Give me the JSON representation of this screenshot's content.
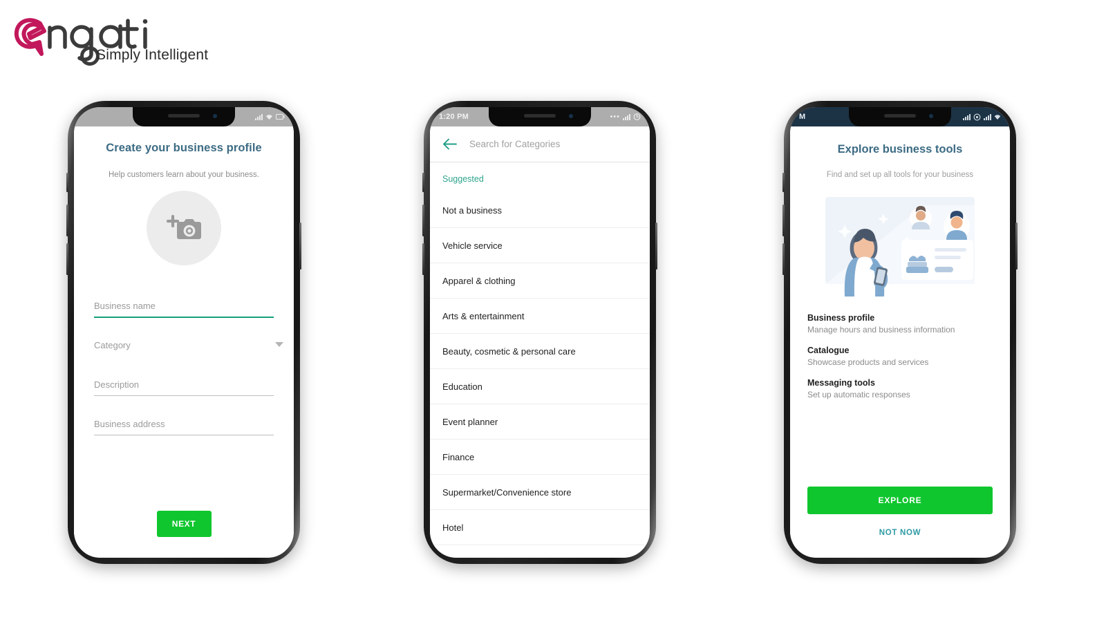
{
  "brand": {
    "name": "engati",
    "tagline": "Simply Intelligent",
    "mark_color": "#c2185b",
    "wordmark_color": "#3b3b3b"
  },
  "colors": {
    "primary_green": "#10c62e",
    "teal": "#2fa48d",
    "title_blue": "#3c6b83",
    "link_teal": "#2e9aa4",
    "field_active": "#14a07c"
  },
  "phones": [
    {
      "id": "create-business-profile",
      "status_bar": {
        "theme": "light",
        "time": "",
        "icons": [
          "signal-icon",
          "wifi-icon",
          "battery-icon"
        ]
      },
      "title": "Create your business profile",
      "subtitle": "Help customers learn about your business.",
      "avatar_icon": "add-photo-camera-icon",
      "fields": [
        {
          "label": "Business name",
          "value": "",
          "state": "active"
        },
        {
          "label": "Category",
          "value": "",
          "state": "dropdown"
        },
        {
          "label": "Description",
          "value": "",
          "state": "default"
        },
        {
          "label": "Business address",
          "value": "",
          "state": "default"
        }
      ],
      "primary_button": "NEXT"
    },
    {
      "id": "search-categories",
      "status_bar": {
        "theme": "light",
        "time": "1:20 PM",
        "icons": [
          "more-icon",
          "signal-icon",
          "battery-icon"
        ]
      },
      "back_icon": "back-arrow-icon",
      "search_placeholder": "Search for Categories",
      "search_value": "",
      "section_header": "Suggested",
      "categories": [
        "Not a business",
        "Vehicle service",
        "Apparel & clothing",
        "Arts & entertainment",
        "Beauty, cosmetic & personal care",
        "Education",
        "Event planner",
        "Finance",
        "Supermarket/Convenience store",
        "Hotel"
      ]
    },
    {
      "id": "explore-business-tools",
      "status_bar": {
        "theme": "dark",
        "time": "M",
        "icons": [
          "signal-icon",
          "alarm-icon",
          "signal-icon",
          "wifi-icon"
        ]
      },
      "title": "Explore business tools",
      "subtitle": "Find and set up all tools for your business",
      "illustration": "shopkeeper-with-phone-illustration",
      "tools": [
        {
          "name": "Business profile",
          "desc": "Manage hours and business information"
        },
        {
          "name": "Catalogue",
          "desc": "Showcase products and services"
        },
        {
          "name": "Messaging tools",
          "desc": "Set up automatic responses"
        }
      ],
      "primary_button": "EXPLORE",
      "secondary_button": "NOT NOW"
    }
  ]
}
